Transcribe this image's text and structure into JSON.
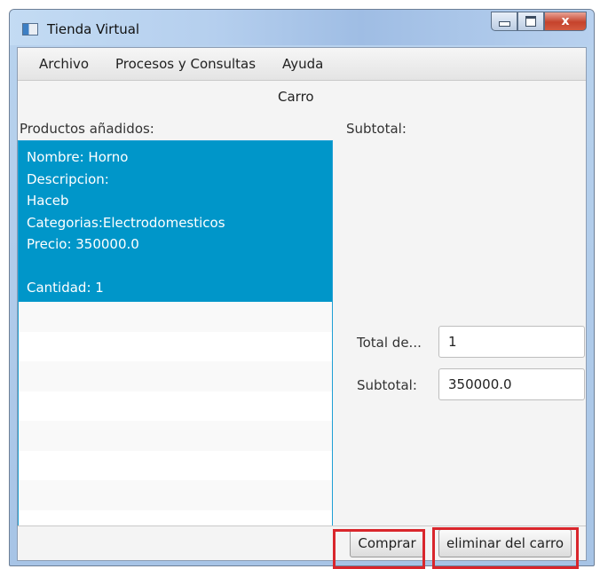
{
  "window": {
    "title": "Tienda Virtual",
    "controls": {
      "close_glyph": "x"
    }
  },
  "menu": {
    "items": [
      "Archivo",
      "Procesos y Consultas",
      "Ayuda"
    ]
  },
  "panel": {
    "heading": "Carro",
    "products_label": "Productos añadidos:",
    "subtotal_header": "Subtotal:"
  },
  "cart_list": {
    "selected_item": {
      "lines": [
        "Nombre: Horno",
        "Descripcion:",
        "Haceb",
        "Categorias:Electrodomesticos",
        "Precio: 350000.0",
        "",
        "Cantidad: 1"
      ]
    }
  },
  "summary": {
    "total_label": "Total de...",
    "total_value": "1",
    "subtotal_label": "Subtotal:",
    "subtotal_value": "350000.0"
  },
  "actions": {
    "buy_label": "Comprar",
    "remove_label": "eliminar del carro"
  },
  "colors": {
    "selection": "#0096c9",
    "highlight_box": "#d9262c"
  },
  "icons": {
    "app": "app-window-icon",
    "minimize": "minimize-icon",
    "maximize": "maximize-icon",
    "close": "close-icon"
  }
}
